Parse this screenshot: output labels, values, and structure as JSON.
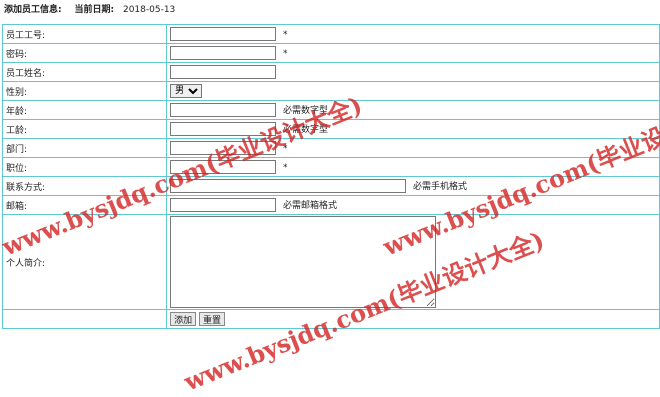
{
  "header": {
    "title": "添加员工信息:",
    "date_label": "当前日期:",
    "date_value": "2018-05-13"
  },
  "form": {
    "employee_id_label": "员工工号:",
    "password_label": "密码:",
    "name_label": "员工姓名:",
    "gender_label": "性别:",
    "gender_selected": "男",
    "age_label": "年龄:",
    "seniority_label": "工龄:",
    "department_label": "部门:",
    "position_label": "职位:",
    "contact_label": "联系方式:",
    "email_label": "邮箱:",
    "intro_label": "个人简介:",
    "required_mark": "*",
    "numeric_hint": "必需数字型",
    "phone_hint": "必需手机格式",
    "email_hint": "必需邮箱格式",
    "add_button": "添加",
    "reset_button": "重置"
  },
  "watermark": {
    "text": "www.bysjdq.com(毕业设计大全)"
  }
}
